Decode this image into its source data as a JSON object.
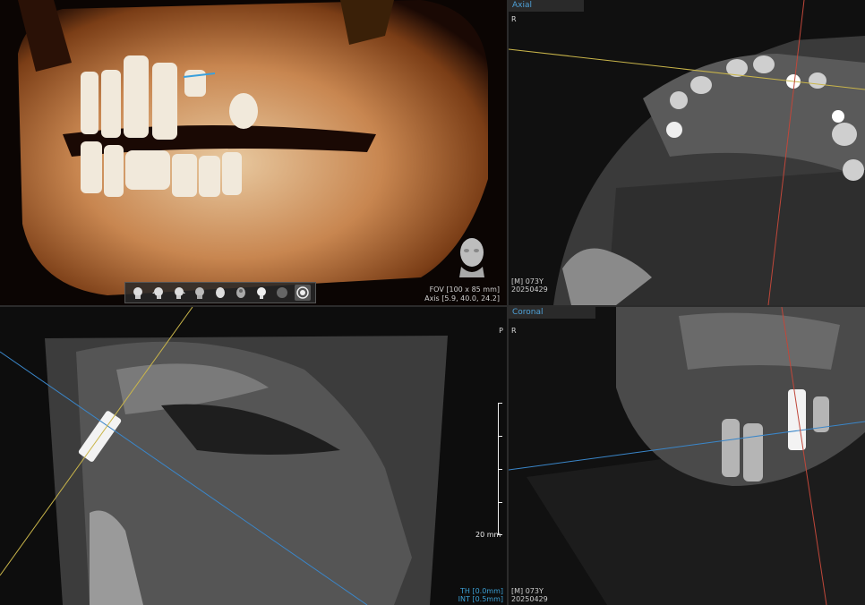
{
  "panels": {
    "volume3d": {
      "fov_text": "FOV [100 x 85 mm]",
      "axis_text": "Axis [5.9, 40.0, 24.2]",
      "toolbar_icons": [
        "head-front-icon",
        "head-left-icon",
        "head-right-icon",
        "head-back-icon",
        "head-top-icon",
        "head-bottom-icon",
        "head-oblique-icon",
        "sphere-icon",
        "reset-view-icon"
      ]
    },
    "axial": {
      "tab_label": "Axial",
      "corner_label": "R",
      "patient_info": "[M] 073Y",
      "date": "20250429"
    },
    "sagittal": {
      "corner_label": "P",
      "scale_label": "20 mm",
      "th_text": "TH [0.0mm]",
      "int_text": "INT [0.5mm]"
    },
    "coronal": {
      "tab_label": "Coronal",
      "corner_label": "R",
      "patient_info": "[M] 073Y",
      "date": "20250429"
    }
  },
  "colors": {
    "tab_text": "#4ea1d8",
    "crosshair_yellow": "#c9b54a",
    "crosshair_blue": "#3a86c9",
    "crosshair_red": "#c0473a"
  }
}
